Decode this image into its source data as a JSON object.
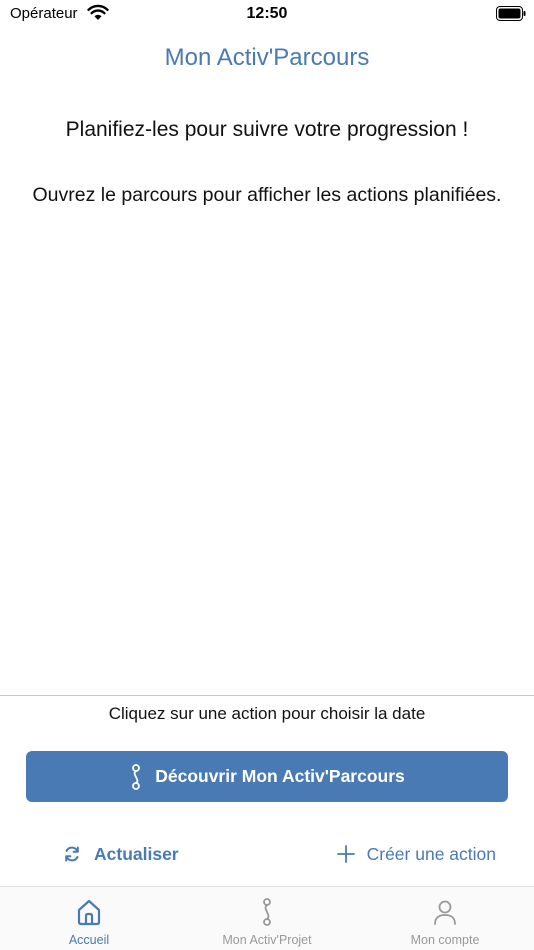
{
  "status_bar": {
    "carrier": "Opérateur",
    "time": "12:50"
  },
  "header": {
    "title": "Mon Activ'Parcours"
  },
  "main": {
    "line1": "Planifiez-les pour suivre votre progression !",
    "line2": "Ouvrez le parcours pour afficher les actions planifiées."
  },
  "footer": {
    "hint": "Cliquez sur une action pour choisir la date",
    "primary_button": "Découvrir Mon Activ'Parcours",
    "refresh_button": "Actualiser",
    "create_button": "Créer une action"
  },
  "tab_bar": {
    "tabs": [
      {
        "label": "Accueil",
        "icon": "home-icon",
        "active": true
      },
      {
        "label": "Mon Activ'Projet",
        "icon": "path-icon",
        "active": false
      },
      {
        "label": "Mon compte",
        "icon": "user-icon",
        "active": false
      }
    ]
  },
  "colors": {
    "accent": "#4a7ab4",
    "inactive": "#999999"
  }
}
